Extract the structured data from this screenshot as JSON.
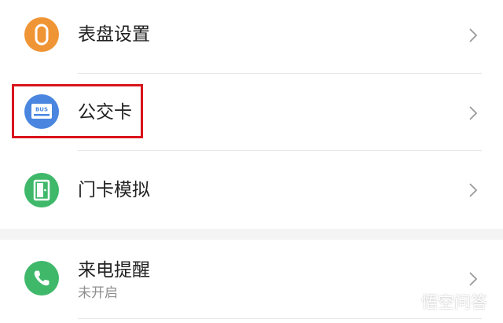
{
  "colors": {
    "watch_face_icon_bg": "#f09535",
    "bus_card_icon_bg": "#4a86e0",
    "door_card_icon_bg": "#3fb86a",
    "call_reminder_icon_bg": "#3fb86a",
    "highlight_border": "#d8141c"
  },
  "settings": {
    "items": [
      {
        "label": "表盘设置",
        "icon": "watch-band-icon"
      },
      {
        "label": "公交卡",
        "icon": "bus-card-icon",
        "icon_text": "BUS",
        "highlighted": true
      },
      {
        "label": "门卡模拟",
        "icon": "door-icon"
      },
      {
        "label": "来电提醒",
        "sublabel": "未开启",
        "icon": "phone-icon"
      }
    ]
  },
  "watermark": {
    "text": "悟空问答",
    "icon": "wukong-logo-icon"
  }
}
